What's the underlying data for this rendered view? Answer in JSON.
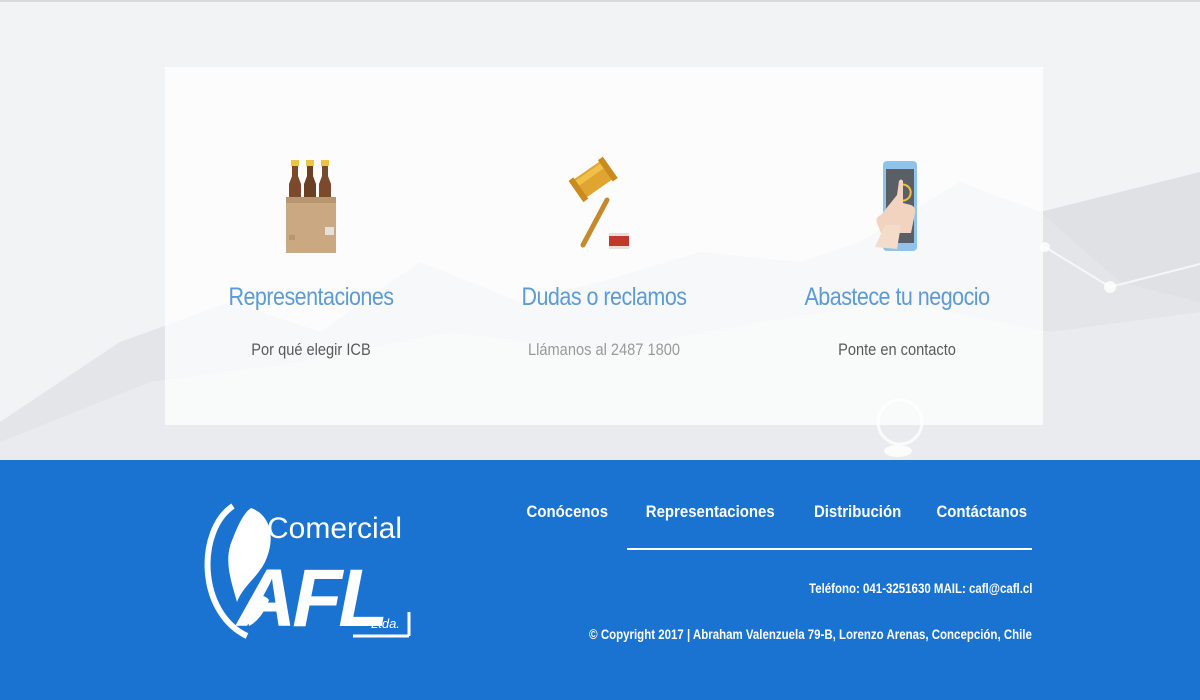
{
  "features": [
    {
      "title": "Representaciones",
      "subtitle": "Por qué elegir ICB",
      "icon": "beer-crate-icon"
    },
    {
      "title": "Dudas o reclamos",
      "subtitle": "Llámanos al 2487 1800",
      "icon": "gavel-icon"
    },
    {
      "title": "Abastece tu negocio",
      "subtitle": "Ponte en contacto",
      "icon": "tablet-touch-icon"
    }
  ],
  "footer": {
    "logo": {
      "top_text": "Comercial",
      "main_text": "AFL",
      "suffix": "Ltda."
    },
    "nav": [
      "Conócenos",
      "Representaciones",
      "Distribución",
      "Contáctanos"
    ],
    "contact": "Teléfono: 041-3251630 MAIL: cafl@cafl.cl",
    "copyright": "© Copyright 2017 | Abraham Valenzuela 79-B, Lorenzo Arenas, Concepción, Chile"
  },
  "colors": {
    "footer_bg": "#1a73d1",
    "title_blue": "#5c9bd6",
    "page_bg": "#f2f3f5"
  }
}
